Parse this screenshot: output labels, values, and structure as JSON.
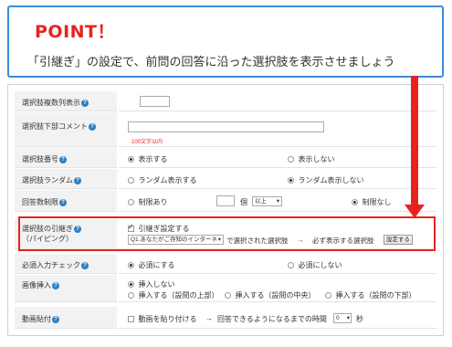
{
  "callout": {
    "title": "POINT！",
    "text": "「引継ぎ」の設定で、前問の回答に沿った選択肢を表示させましょう"
  },
  "help_icon_glyph": "?",
  "rows": {
    "columns": {
      "label": "選択肢複数列表示"
    },
    "comment": {
      "label": "選択肢下部コメント",
      "hint": "100文字以内"
    },
    "numbering": {
      "label": "選択肢番号",
      "opt1": "表示する",
      "opt2": "表示しない"
    },
    "random": {
      "label": "選択肢ランダム",
      "opt1": "ランダム表示する",
      "opt2": "ランダム表示しない"
    },
    "limit": {
      "label": "回答数制限",
      "opt1": "制限あり",
      "unit": "個",
      "select": "以上",
      "opt2": "制限なし"
    },
    "piping": {
      "label_line1": "選択肢の引継ぎ",
      "label_line2": "（パイピング）",
      "checkbox_label": "引継ぎ設定する",
      "question_select": "Q1.あなたがご存知のインターネ",
      "middle_text": "で選択された選択肢",
      "arrow": "→",
      "tail_text": "必ず表示する選択肢",
      "button": "設定する"
    },
    "required": {
      "label": "必須入力チェック",
      "opt1": "必須にする",
      "opt2": "必須にしない"
    },
    "image": {
      "label": "画像挿入",
      "opt_none": "挿入しない",
      "opt_top": "挿入する（設問の上部）",
      "opt_middle": "挿入する（設問の中央）",
      "opt_bottom": "挿入する（設問の下部）"
    },
    "video": {
      "label": "動画貼付",
      "checkbox_label": "動画を貼り付ける",
      "arrow": "→",
      "text": "回答できるようになるまでの時間",
      "select": "0",
      "unit": "秒"
    }
  },
  "colors": {
    "accent_red": "#e8231f",
    "callout_border": "#3b8bd8",
    "help_icon": "#2c7fc4"
  }
}
